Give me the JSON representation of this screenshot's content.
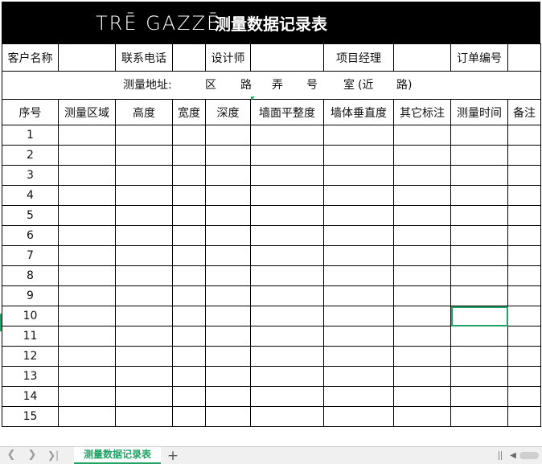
{
  "banner": {
    "logo": "TRĒ GAZZĒ",
    "title": "测量数据记录表"
  },
  "info_row": {
    "customer_label": "客户名称",
    "customer_value": "",
    "phone_label": "联系电话",
    "phone_value": "",
    "designer_label": "设计师",
    "designer_value": "",
    "manager_label": "项目经理",
    "manager_value": "",
    "order_label": "订单编号",
    "order_value": ""
  },
  "address": {
    "label": "测量地址:",
    "district": "区",
    "road": "路",
    "lane": "弄",
    "number": "号",
    "room": "室",
    "near": "(近",
    "near_road": "路)"
  },
  "columns": [
    "序号",
    "测量区域",
    "高度",
    "宽度",
    "深度",
    "墙面平整度",
    "墙体垂直度",
    "其它标注",
    "测量时间",
    "备注"
  ],
  "rows": [
    "1",
    "2",
    "3",
    "4",
    "5",
    "6",
    "7",
    "8",
    "9",
    "10",
    "11",
    "12",
    "13",
    "14",
    "15"
  ],
  "sheet_tabs": {
    "active": "测量数据记录表"
  },
  "colors": {
    "accent": "#21a366",
    "banner_bg": "#000000"
  },
  "icons": {
    "first": "chevron-left-icon",
    "prev": "chevron-left-icon",
    "last": "chevron-last-icon",
    "add": "plus-icon"
  }
}
